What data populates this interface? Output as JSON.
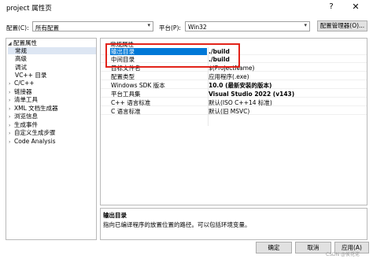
{
  "window": {
    "title": "project 属性页",
    "help_glyph": "?",
    "close_glyph": "✕"
  },
  "toolbar": {
    "config_label": "配置(C):",
    "config_value": "所有配置",
    "platform_label": "平台(P):",
    "platform_value": "Win32",
    "config_manager_label": "配置管理器(O)..."
  },
  "tree": {
    "items": [
      {
        "label": "配置属性",
        "toggle": "◢"
      },
      {
        "label": "常规",
        "toggle": ""
      },
      {
        "label": "高级",
        "toggle": ""
      },
      {
        "label": "调试",
        "toggle": ""
      },
      {
        "label": "VC++ 目录",
        "toggle": ""
      },
      {
        "label": "C/C++",
        "toggle": "›"
      },
      {
        "label": "链接器",
        "toggle": "›"
      },
      {
        "label": "清单工具",
        "toggle": "›"
      },
      {
        "label": "XML 文档生成器",
        "toggle": "›"
      },
      {
        "label": "浏览信息",
        "toggle": "›"
      },
      {
        "label": "生成事件",
        "toggle": "›"
      },
      {
        "label": "自定义生成步骤",
        "toggle": "›"
      },
      {
        "label": "Code Analysis",
        "toggle": "›"
      }
    ]
  },
  "grid": {
    "category": "常规属性",
    "rows": [
      {
        "name": "输出目录",
        "value": "./build"
      },
      {
        "name": "中间目录",
        "value": "./build"
      },
      {
        "name": "目标文件名",
        "value": "$(ProjectName)"
      },
      {
        "name": "配置类型",
        "value": "应用程序(.exe)"
      },
      {
        "name": "Windows SDK 版本",
        "value": "10.0 (最新安装的版本)"
      },
      {
        "name": "平台工具集",
        "value": "Visual Studio 2022 (v143)"
      },
      {
        "name": "C++ 语言标准",
        "value": "默认(ISO C++14 标准)"
      },
      {
        "name": "C 语言标准",
        "value": "默认(旧 MSVC)"
      }
    ]
  },
  "description": {
    "title": "输出目录",
    "text": "指向已编译程序的放置位置的路径。可以包括环境变量。"
  },
  "buttons": {
    "ok": "确定",
    "cancel": "取消",
    "apply": "应用(A)"
  },
  "watermark": "CSDN @侯花佬"
}
